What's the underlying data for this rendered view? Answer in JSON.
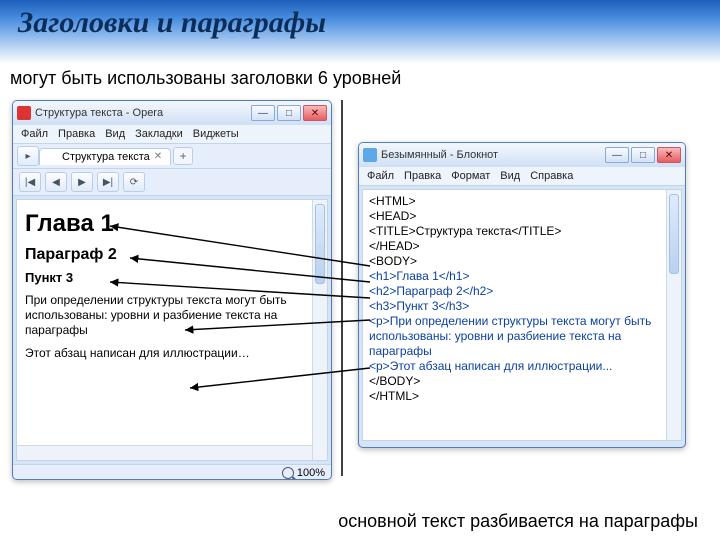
{
  "header": {
    "title": "Заголовки и параграфы"
  },
  "subtitle": "могут быть использованы заголовки 6 уровней",
  "bottom_caption": "основной текст разбивается на параграфы",
  "browser": {
    "window_title": "Структура текста - Opera",
    "menu": [
      "Файл",
      "Правка",
      "Вид",
      "Закладки",
      "Виджеты"
    ],
    "tab_label": "Структура текста",
    "nav_btns": [
      "|◀",
      "◀",
      "▶",
      "▶|",
      "⟳"
    ],
    "page": {
      "h1": "Глава 1",
      "h2": "Параграф 2",
      "h3": "Пункт 3",
      "p1": "При определении структуры текста могут быть использованы: уровни и разбиение текста на параграфы",
      "p2": "Этот абзац написан для иллюстрации…"
    },
    "zoom": "100%"
  },
  "notepad": {
    "window_title": "Безымянный - Блокнот",
    "menu": [
      "Файл",
      "Правка",
      "Формат",
      "Вид",
      "Справка"
    ],
    "lines": [
      "<HTML>",
      "<HEAD>",
      "<TITLE>Структура текста</TITLE>",
      "</HEAD>",
      "<BODY>",
      "<h1>Глава 1</h1>",
      "<h2>Параграф 2</h2>",
      "<h3>Пункт 3</h3>",
      "<p>При определении структуры текста могут быть использованы: уровни и разбиение текста на параграфы",
      "<p>Этот абзац написан для иллюстрации...",
      "</BODY>",
      "</HTML>"
    ]
  }
}
